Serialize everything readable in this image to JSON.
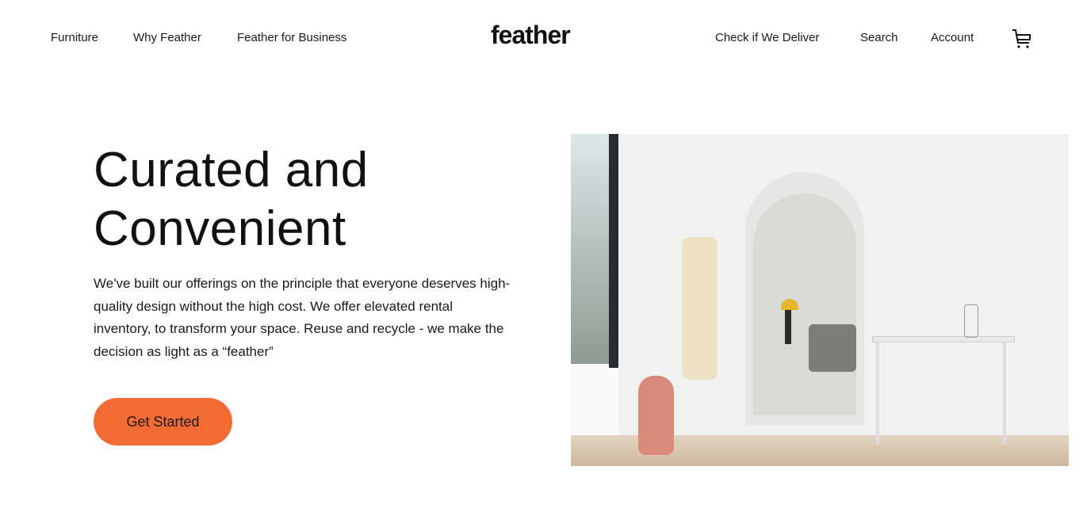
{
  "nav": {
    "left": [
      "Furniture",
      "Why Feather",
      "Feather for Business"
    ],
    "logo": "feather",
    "right": [
      "Check if We Deliver",
      "Search",
      "Account"
    ],
    "cart_icon": "cart-icon"
  },
  "hero": {
    "title_line1": "Curated and",
    "title_line2": "Convenient",
    "description": "We've built our offerings on the principle that everyone deserves high-quality design without the high cost. We offer elevated rental inventory, to transform your space. Reuse and recycle - we make the decision as light as a “feather”",
    "cta_label": "Get Started",
    "accent_color": "#f26b35"
  }
}
